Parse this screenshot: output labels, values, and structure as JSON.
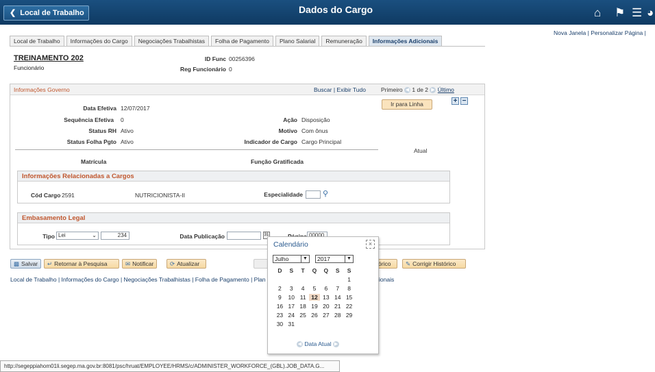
{
  "header": {
    "back_label": "Local de Trabalho",
    "title": "Dados do Cargo",
    "links": [
      "Nova Janela",
      "Personalizar Página"
    ]
  },
  "tabs": [
    "Local de Trabalho",
    "Informações do Cargo",
    "Negociações Trabalhistas",
    "Folha de Pagamento",
    "Plano Salarial",
    "Remuneração",
    "Informações Adicionais"
  ],
  "active_tab": "Informações Adicionais",
  "employee": {
    "name": "TREINAMENTO 202",
    "type": "Funcionário",
    "id_func_label": "ID Func",
    "id_func": "00256396",
    "reg_label": "Reg Funcionário",
    "reg": "0"
  },
  "panel": {
    "title": "Informações Governo",
    "buscar": "Buscar",
    "exibir_tudo": "Exibir Tudo",
    "primeiro": "Primeiro",
    "page_info": "1 de 2",
    "ultimo": "Último",
    "ir_para_linha": "Ir para Linha",
    "fields": {
      "data_efetiva_label": "Data Efetiva",
      "data_efetiva": "12/07/2017",
      "sequencia_label": "Sequência Efetiva",
      "sequencia": "0",
      "status_rh_label": "Status RH",
      "status_rh": "Ativo",
      "status_folha_label": "Status Folha Pgto",
      "status_folha": "Ativo",
      "acao_label": "Ação",
      "acao": "Disposição",
      "motivo_label": "Motivo",
      "motivo": "Com ônus",
      "indicador_label": "Indicador de Cargo",
      "indicador": "Cargo Principal",
      "atual": "Atual",
      "matricula_label": "Matrícula",
      "funcao_label": "Função Gratificada"
    },
    "cargos": {
      "title": "Informações Relacionadas a Cargos",
      "cod_cargo_label": "Cód Cargo",
      "cod_cargo": "2591",
      "cargo_desc": "NUTRICIONISTA-II",
      "especialidade_label": "Especialidade",
      "especialidade": ""
    },
    "legal": {
      "title": "Embasamento Legal",
      "tipo_label": "Tipo",
      "tipo": "Lei",
      "numero": "234",
      "data_pub_label": "Data Publicação",
      "data_pub": "",
      "pagina_label": "Página",
      "pagina": "00000"
    }
  },
  "buttons": {
    "salvar": "Salvar",
    "retornar": "Retornar à Pesquisa",
    "notificar": "Notificar",
    "atualizar": "Atualizar",
    "historico_partial": "órico",
    "corrigir": "Corrigir Histórico"
  },
  "bottom_links": {
    "left": "Local de Trabalho | Informações do Cargo | Negociações Trabalhistas | Folha de Pagamento | Plan",
    "right": "ionais"
  },
  "calendar": {
    "title": "Calendário",
    "month": "Julho",
    "year": "2017",
    "weekdays": [
      "D",
      "S",
      "T",
      "Q",
      "Q",
      "S",
      "S"
    ],
    "weeks": [
      [
        "",
        "",
        "",
        "",
        "",
        "",
        "1"
      ],
      [
        "2",
        "3",
        "4",
        "5",
        "6",
        "7",
        "8"
      ],
      [
        "9",
        "10",
        "11",
        "12",
        "13",
        "14",
        "15"
      ],
      [
        "16",
        "17",
        "18",
        "19",
        "20",
        "21",
        "22"
      ],
      [
        "23",
        "24",
        "25",
        "26",
        "27",
        "28",
        "29"
      ],
      [
        "30",
        "31",
        "",
        "",
        "",
        "",
        ""
      ]
    ],
    "today": "12",
    "data_atual": "Data Atual"
  },
  "status_bar": "http://segeppiahom01li.segep.ma.gov.br:8081/psc/hruat/EMPLOYEE/HRMS/c/ADMINISTER_WORKFORCE_(GBL).JOB_DATA.G..."
}
